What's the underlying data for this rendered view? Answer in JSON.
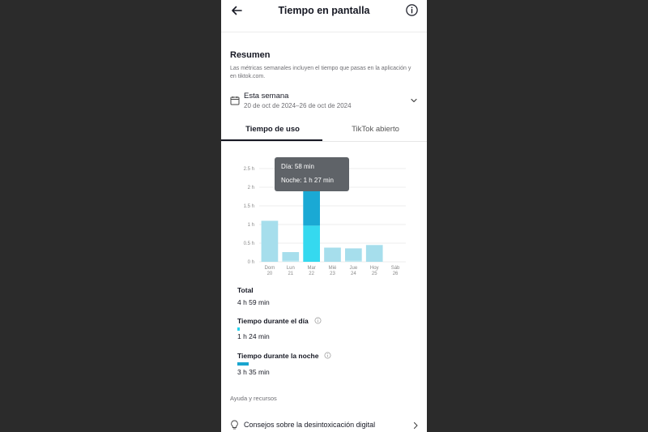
{
  "header": {
    "title": "Tiempo en pantalla",
    "back_icon": "arrow-left-icon",
    "info_icon": "info-circle-icon"
  },
  "summary": {
    "title": "Resumen",
    "description": "Las métricas semanales incluyen el tiempo que pasas en la aplicación y en tiktok.com.",
    "week_label": "Esta semana",
    "week_range": "20 de oct de 2024–26 de oct de 2024"
  },
  "tabs": [
    {
      "label": "Tiempo de uso",
      "active": true
    },
    {
      "label": "TikTok abierto",
      "active": false
    }
  ],
  "tooltip": {
    "day": "Día: 58 min",
    "night": "Noche: 1 h 27 min"
  },
  "chart_data": {
    "type": "bar",
    "stacked": true,
    "categories": [
      "Dom",
      "Lun",
      "Mar",
      "Mié",
      "Jue",
      "Hoy",
      "Sáb"
    ],
    "dates": [
      "20",
      "21",
      "22",
      "23",
      "24",
      "25",
      "26"
    ],
    "ytick_labels": [
      "0 h",
      "0.5 h",
      "1 h",
      "1.5 h",
      "2 h",
      "2.5 h"
    ],
    "yticks": [
      0,
      0.5,
      1,
      1.5,
      2,
      2.5
    ],
    "ylim": [
      0,
      2.5
    ],
    "series": [
      {
        "name": "Día",
        "color": "#bfe9f2",
        "selected_color": "#35d9ef",
        "values": [
          0,
          0.03,
          0.97,
          0,
          0.03,
          0,
          0
        ]
      },
      {
        "name": "Noche",
        "color": "#a6deec",
        "selected_color": "#1aa9d4",
        "values": [
          1.1,
          0.23,
          1.45,
          0.38,
          0.33,
          0.45,
          0
        ]
      }
    ],
    "selected_index": 2,
    "grid": true
  },
  "stats": {
    "total_label": "Total",
    "total_value": "4 h 59 min",
    "day_label": "Tiempo durante el día",
    "day_value": "1 h 24 min",
    "night_label": "Tiempo durante la noche",
    "night_value": "3 h 35 min"
  },
  "help": {
    "title": "Ayuda y recursos",
    "item": "Consejos sobre la desintoxicación digital"
  }
}
